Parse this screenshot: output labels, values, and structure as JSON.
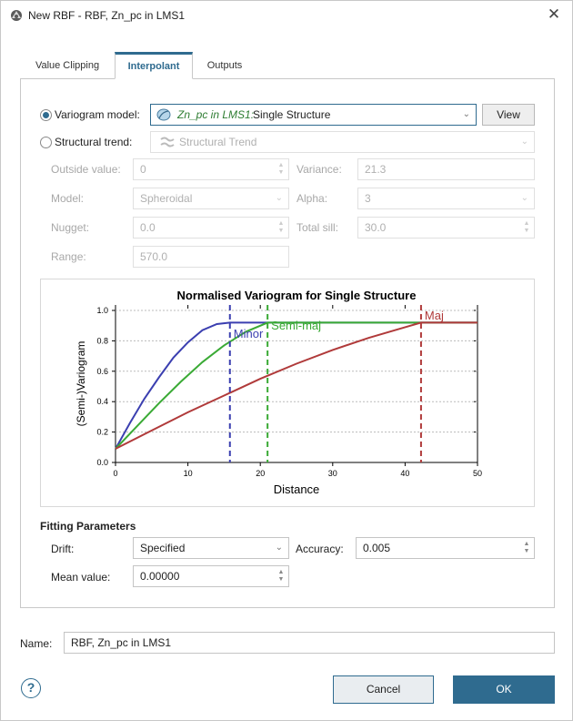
{
  "window": {
    "title": "New RBF - RBF, Zn_pc in LMS1"
  },
  "tabs": [
    {
      "label": "Value Clipping"
    },
    {
      "label": "Interpolant"
    },
    {
      "label": "Outputs"
    }
  ],
  "variogram": {
    "label": "Variogram model:",
    "source": "Zn_pc in LMS1:",
    "structure": "Single Structure",
    "view_label": "View"
  },
  "trend": {
    "label": "Structural trend:",
    "value": "Structural Trend"
  },
  "params": {
    "outside_label": "Outside value:",
    "outside_value": "0",
    "variance_label": "Variance:",
    "variance_value": "21.3",
    "model_label": "Model:",
    "model_value": "Spheroidal",
    "alpha_label": "Alpha:",
    "alpha_value": "3",
    "nugget_label": "Nugget:",
    "nugget_value": "0.0",
    "sill_label": "Total sill:",
    "sill_value": "30.0",
    "range_label": "Range:",
    "range_value": "570.0"
  },
  "chart_data": {
    "type": "line",
    "title": "Normalised Variogram for Single Structure",
    "xlabel": "Distance",
    "ylabel": "(Semi-)Variogram",
    "xlim": [
      0,
      50
    ],
    "ylim": [
      0,
      1.0
    ],
    "xticks": [
      "0",
      "10",
      "20",
      "30",
      "40",
      "50"
    ],
    "yticks": [
      "0.0",
      "0.2",
      "0.4",
      "0.6",
      "0.8",
      "1.0"
    ],
    "grid": "horizontal dashed",
    "series": [
      {
        "name": "Minor",
        "color": "#3b3fb0",
        "x": [
          0,
          2,
          4,
          6,
          8,
          10,
          12,
          14,
          15.8,
          50
        ],
        "values": [
          0.09,
          0.26,
          0.42,
          0.56,
          0.69,
          0.79,
          0.87,
          0.91,
          0.92,
          0.92
        ]
      },
      {
        "name": "Semi-maj",
        "color": "#3aaa35",
        "x": [
          0,
          3,
          6,
          9,
          12,
          15,
          18,
          21,
          50
        ],
        "values": [
          0.09,
          0.24,
          0.39,
          0.53,
          0.66,
          0.77,
          0.86,
          0.92,
          0.92
        ]
      },
      {
        "name": "Maj",
        "color": "#b03a3a",
        "x": [
          0,
          5,
          10,
          15,
          20,
          25,
          30,
          35,
          40,
          42.2,
          50
        ],
        "values": [
          0.09,
          0.21,
          0.33,
          0.44,
          0.55,
          0.65,
          0.74,
          0.82,
          0.89,
          0.92,
          0.92
        ]
      }
    ],
    "range_markers": [
      {
        "label": "Minor",
        "x": 15.8,
        "color": "#3b3fb0"
      },
      {
        "label": "Semi-maj",
        "x": 21,
        "color": "#3aaa35"
      },
      {
        "label": "Maj",
        "x": 42.2,
        "color": "#b03a3a"
      }
    ]
  },
  "fitting": {
    "heading": "Fitting Parameters",
    "drift_label": "Drift:",
    "drift_value": "Specified",
    "accuracy_label": "Accuracy:",
    "accuracy_value": "0.005",
    "mean_label": "Mean value:",
    "mean_value": "0.00000"
  },
  "name_field": {
    "label": "Name:",
    "value": "RBF, Zn_pc in LMS1"
  },
  "buttons": {
    "cancel": "Cancel",
    "ok": "OK",
    "help": "?"
  }
}
